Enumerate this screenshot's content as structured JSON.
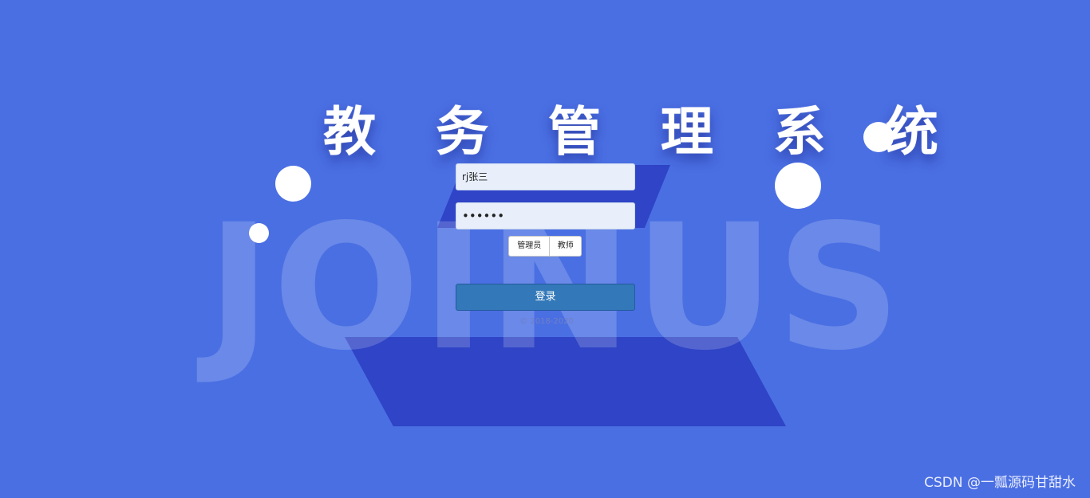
{
  "background": {
    "watermark_text": "JOINUS",
    "colors": {
      "page": "#4a6fe3",
      "shape": "#2f44c6",
      "button": "#3378b8"
    }
  },
  "title": {
    "text": "教 务 管 理 系 统"
  },
  "login_form": {
    "username_value": "rj张三",
    "password_mask": "••••••",
    "roles": [
      "管理员",
      "教师"
    ],
    "login_button": "登录",
    "copyright": "© 2018-2020"
  },
  "page_watermark": {
    "text": "CSDN @一瓢源码甘甜水"
  }
}
